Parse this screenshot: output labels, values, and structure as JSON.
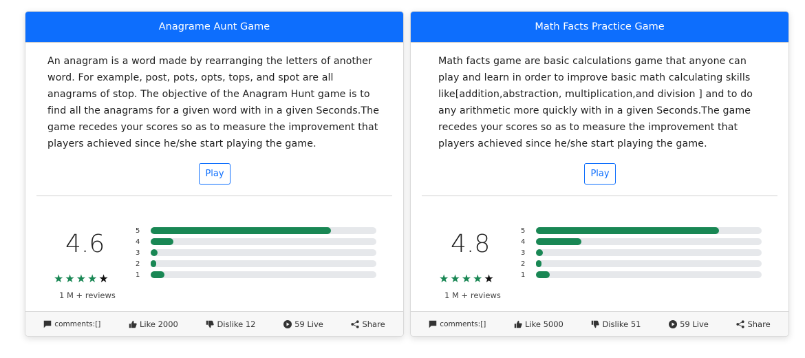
{
  "cards": [
    {
      "title": "Anagrame Aunt Game",
      "description": "An anagram is a word made by rearranging the letters of another word. For example, post, pots, opts, tops, and spot are all anagrams of stop. The objective of the Anagram Hunt game is to find all the anagrams for a given word with in a given Seconds.The game recedes your scores so as to measure the improvement that players achieved since he/she start playing the game.",
      "play_label": "Play",
      "rating": "4.6",
      "reviews": "1 M + reviews",
      "bars": [
        {
          "label": "5",
          "fraction": 0.8
        },
        {
          "label": "4",
          "fraction": 0.1
        },
        {
          "label": "3",
          "fraction": 0.03
        },
        {
          "label": "2",
          "fraction": 0.02
        },
        {
          "label": "1",
          "fraction": 0.06
        }
      ],
      "footer": {
        "comments": "comments:[]",
        "like": "Like 2000",
        "dislike": "Dislike 12",
        "live": "59 Live",
        "share": "Share"
      }
    },
    {
      "title": "Math Facts Practice Game",
      "description": "Math facts game are basic calculations game that anyone can play and learn in order to improve basic math calculating skills like[addition,abstraction, multiplication,and division ] and to do any arithmetic more quickly with in a given Seconds.The game recedes your scores so as to measure the improvement that players achieved since he/she start playing the game.",
      "play_label": "Play",
      "rating": "4.8",
      "reviews": "1 M + reviews",
      "bars": [
        {
          "label": "5",
          "fraction": 0.81
        },
        {
          "label": "4",
          "fraction": 0.2
        },
        {
          "label": "3",
          "fraction": 0.03
        },
        {
          "label": "2",
          "fraction": 0.02
        },
        {
          "label": "1",
          "fraction": 0.06
        }
      ],
      "footer": {
        "comments": "comments:[]",
        "like": "Like 5000",
        "dislike": "Dislike 51",
        "live": "59 Live",
        "share": "Share"
      }
    }
  ],
  "colors": {
    "header": "#0d6efd",
    "bar_fill": "#198754",
    "bar_track": "#e6e8eb",
    "star": "#198754"
  },
  "icons": [
    "comment-icon",
    "thumbs-up-icon",
    "thumbs-down-icon",
    "play-circle-icon",
    "share-icon",
    "star-icon",
    "half-star-icon"
  ]
}
